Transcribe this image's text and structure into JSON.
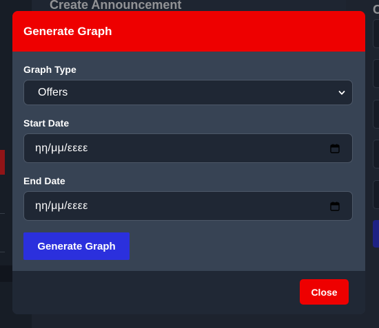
{
  "background": {
    "card_title": "Create Announcement",
    "right_title": "C"
  },
  "modal": {
    "title": "Generate Graph",
    "graph_type": {
      "label": "Graph Type",
      "selected": "Offers"
    },
    "start_date": {
      "label": "Start Date",
      "value": "ηη/μμ/εεεε"
    },
    "end_date": {
      "label": "End Date",
      "value": "ηη/μμ/εεεε"
    },
    "generate_label": "Generate Graph",
    "close_label": "Close"
  },
  "colors": {
    "header": "#ee0000",
    "primary_button": "#2b30dd",
    "close_button": "#ee0000",
    "modal_bg": "#374354",
    "input_bg": "#1f2734"
  }
}
